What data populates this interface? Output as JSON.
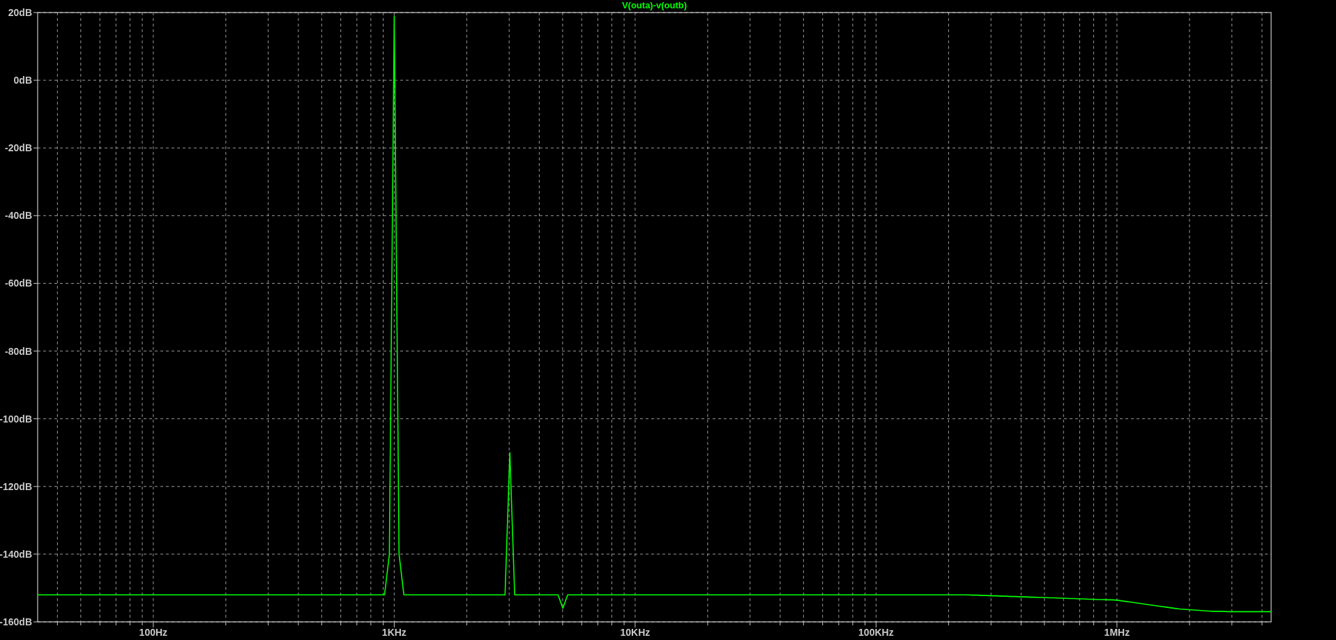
{
  "plot": {
    "chart_data": {
      "type": "line",
      "grid": true,
      "ylim": [
        -160,
        20
      ],
      "yticks": [
        {
          "value": 20,
          "label": "20dB"
        },
        {
          "value": 0,
          "label": "0dB"
        },
        {
          "value": -20,
          "label": "-20dB"
        },
        {
          "value": -40,
          "label": "-40dB"
        },
        {
          "value": -60,
          "label": "-60dB"
        },
        {
          "value": -80,
          "label": "-80dB"
        },
        {
          "value": -100,
          "label": "-100dB"
        },
        {
          "value": -120,
          "label": "-120dB"
        },
        {
          "value": -140,
          "label": "-140dB"
        },
        {
          "value": -160,
          "label": "-160dB"
        }
      ],
      "categories": [
        null,
        null,
        null,
        null,
        null,
        null,
        null,
        null,
        null,
        null,
        null,
        null,
        null,
        null,
        null,
        null,
        null,
        null,
        null,
        null,
        null,
        null,
        null,
        null,
        "100Hz",
        null,
        null,
        null,
        null,
        null,
        null,
        null,
        null,
        null,
        null,
        null,
        null,
        null,
        null,
        null,
        null,
        null,
        null,
        null,
        null,
        null,
        null,
        null,
        null,
        null,
        null,
        null,
        null,
        null,
        null,
        null,
        null,
        null,
        null,
        null,
        null,
        null,
        null,
        null,
        null,
        null,
        null,
        null,
        null,
        null,
        null,
        null,
        null,
        null,
        "1KHz",
        null,
        null,
        null,
        null,
        null,
        null,
        null,
        null,
        null,
        null,
        null,
        null,
        null,
        null,
        null,
        null,
        null,
        null,
        null,
        null,
        null,
        null,
        null,
        null,
        null,
        null,
        null,
        null,
        null,
        null,
        null,
        null,
        null,
        null,
        null,
        null,
        null,
        null,
        null,
        null,
        null,
        null,
        null,
        null,
        null,
        null,
        null,
        null,
        null,
        "10KHz",
        null,
        null,
        null,
        null,
        null,
        null,
        null,
        null,
        null,
        null,
        null,
        null,
        null,
        null,
        null,
        null,
        null,
        null,
        null,
        null,
        null,
        null,
        null,
        null,
        null,
        null,
        null,
        null,
        null,
        null,
        null,
        null,
        null,
        null,
        null,
        null,
        null,
        null,
        null,
        null,
        null,
        null,
        null,
        null,
        null,
        null,
        null,
        null,
        null,
        "100KHz",
        null,
        null,
        null,
        null,
        null,
        null,
        null,
        null,
        null,
        null,
        null,
        null,
        null,
        null,
        null,
        null,
        null,
        null,
        null,
        null,
        null,
        null,
        null,
        null,
        null,
        null,
        null,
        null,
        null,
        null,
        null,
        null,
        null,
        null,
        null,
        null,
        null,
        null,
        null,
        null,
        null,
        null,
        null,
        null,
        null,
        null,
        null,
        null,
        null,
        "1MHz",
        null,
        null,
        null,
        null,
        null,
        null,
        null,
        null,
        null,
        null,
        null,
        null,
        null,
        null,
        null,
        null,
        null,
        null,
        null,
        null,
        null,
        null,
        null,
        null,
        null,
        null,
        null,
        null,
        null,
        null,
        null,
        null
      ],
      "series": [
        {
          "name": "V(outa)-v(outb)",
          "color": "#00ff00",
          "values": [
            -152,
            -152,
            -152,
            -152,
            -152,
            -152,
            -152,
            -152,
            -152,
            -152,
            -152,
            -152,
            -152,
            -152,
            -152,
            -152,
            -152,
            -152,
            -152,
            -152,
            -152,
            -152,
            -152,
            -152,
            -152,
            -152,
            -152,
            -152,
            -152,
            -152,
            -152,
            -152,
            -152,
            -152,
            -152,
            -152,
            -152,
            -152,
            -152,
            -152,
            -152,
            -152,
            -152,
            -152,
            -152,
            -152,
            -152,
            -152,
            -152,
            -152,
            -152,
            -152,
            -152,
            -152,
            -152,
            -152,
            -152,
            -152,
            -152,
            -152,
            -152,
            -152,
            -152,
            -152,
            -152,
            -152,
            -152,
            -152,
            -152,
            -152,
            -152,
            -152,
            -152,
            -140,
            19,
            -140,
            -152,
            -152,
            -152,
            -152,
            -152,
            -152,
            -152,
            -152,
            -152,
            -152,
            -152,
            -152,
            -152,
            -152,
            -152,
            -152,
            -152,
            -152,
            -152,
            -152,
            -152,
            -152,
            -110,
            -152,
            -152,
            -152,
            -152,
            -152,
            -152,
            -152,
            -152,
            -152,
            -152,
            -156,
            -152,
            -152,
            -152,
            -152,
            -152,
            -152,
            -152,
            -152,
            -152,
            -152,
            -152,
            -152,
            -152,
            -152,
            -152,
            -152,
            -152,
            -152,
            -152,
            -152,
            -152,
            -152,
            -152,
            -152,
            -152,
            -152,
            -152,
            -152,
            -152,
            -152,
            -152,
            -152,
            -152,
            -152,
            -152,
            -152,
            -152,
            -152,
            -152,
            -152,
            -152,
            -152,
            -152,
            -152,
            -152,
            -152,
            -152,
            -152,
            -152,
            -152,
            -152,
            -152,
            -152,
            -152,
            -152,
            -152,
            -152,
            -152,
            -152,
            -152,
            -152,
            -152,
            -152,
            -152,
            -152,
            -152,
            -152,
            -152,
            -152,
            -152,
            -152,
            -152,
            -152,
            -152,
            -152,
            -152,
            -152,
            -152,
            -152,
            -152,
            -152,
            -152,
            -152,
            -152,
            -152.1,
            -152.1,
            -152.2,
            -152.2,
            -152.3,
            -152.3,
            -152.4,
            -152.4,
            -152.5,
            -152.5,
            -152.6,
            -152.6,
            -152.7,
            -152.7,
            -152.8,
            -152.8,
            -152.9,
            -152.9,
            -153,
            -153,
            -153.1,
            -153.1,
            -153.2,
            -153.2,
            -153.3,
            -153.3,
            -153.4,
            -153.4,
            -153.5,
            -153.5,
            -153.6,
            -153.8,
            -154,
            -154.2,
            -154.4,
            -154.6,
            -154.8,
            -155,
            -155.2,
            -155.4,
            -155.6,
            -155.8,
            -156,
            -156.2,
            -156.3,
            -156.4,
            -156.5,
            -156.6,
            -156.7,
            -156.8,
            -156.9,
            -156.9,
            -156.9,
            -157,
            -157,
            -157,
            -157,
            -157,
            -157,
            -157,
            -157,
            -157,
            -157
          ]
        }
      ]
    }
  }
}
